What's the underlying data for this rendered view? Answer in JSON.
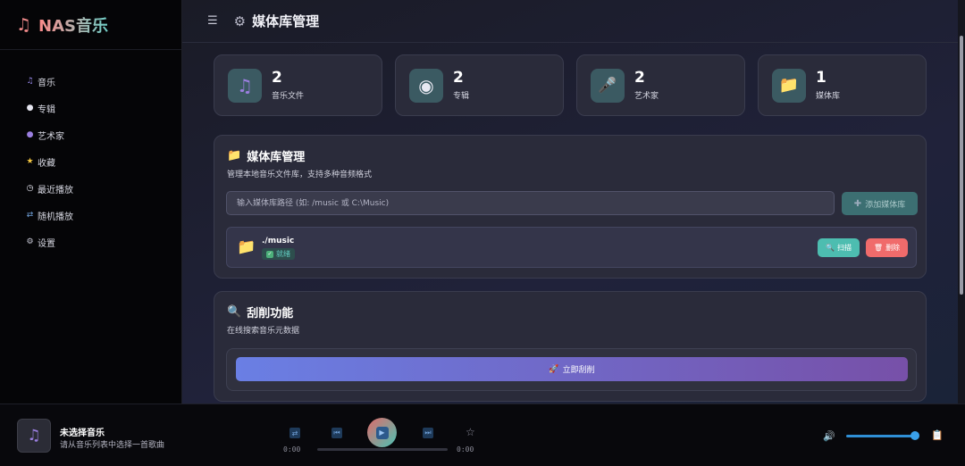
{
  "brand": {
    "icon": "♫",
    "name": "NAS音乐"
  },
  "sidebar": {
    "items": [
      {
        "icon": "♫",
        "icon_name": "music-note-icon",
        "label": "音乐"
      },
      {
        "icon": "●",
        "icon_name": "disc-icon",
        "label": "专辑"
      },
      {
        "icon": "●",
        "icon_name": "person-icon",
        "label": "艺术家"
      },
      {
        "icon": "★",
        "icon_name": "star-icon",
        "label": "收藏"
      },
      {
        "icon": "◷",
        "icon_name": "clock-icon",
        "label": "最近播放"
      },
      {
        "icon": "⇄",
        "icon_name": "shuffle-icon",
        "label": "随机播放"
      },
      {
        "icon": "⚙",
        "icon_name": "gear-icon",
        "label": "设置"
      }
    ]
  },
  "header": {
    "menu_icon": "☰",
    "title_icon": "⚙",
    "title": "媒体库管理"
  },
  "stats": [
    {
      "icon": "♫",
      "icon_name": "music-note-icon",
      "value": "2",
      "label": "音乐文件"
    },
    {
      "icon": "◉",
      "icon_name": "disc-icon",
      "value": "2",
      "label": "专辑"
    },
    {
      "icon": "🎤",
      "icon_name": "microphone-icon",
      "value": "2",
      "label": "艺术家"
    },
    {
      "icon": "📁",
      "icon_name": "folder-icon",
      "value": "1",
      "label": "媒体库"
    }
  ],
  "library": {
    "title_icon": "📁",
    "title": "媒体库管理",
    "subtitle": "管理本地音乐文件库，支持多种音频格式",
    "path_placeholder": "输入媒体库路径 (如: /music 或 C:\\Music)",
    "add_label": "添加媒体库",
    "items": [
      {
        "path": "./music",
        "status": "就绪",
        "scan_label": "扫描",
        "delete_label": "删除"
      }
    ]
  },
  "scrape": {
    "title_icon": "🔍",
    "title": "刮削功能",
    "subtitle": "在线搜索音乐元数据",
    "button_label": "立即刮削"
  },
  "player": {
    "title": "未选择音乐",
    "subtitle": "请从音乐列表中选择一首歌曲",
    "current_time": "0:00",
    "duration": "0:00",
    "progress": 0,
    "volume": 1.0
  },
  "colors": {
    "accent_teal": "#4dbdb0",
    "accent_red": "#f06b6b",
    "accent_blue": "#2f8fd6",
    "gradient_start": "#6a7fe4",
    "gradient_end": "#7750a8"
  }
}
